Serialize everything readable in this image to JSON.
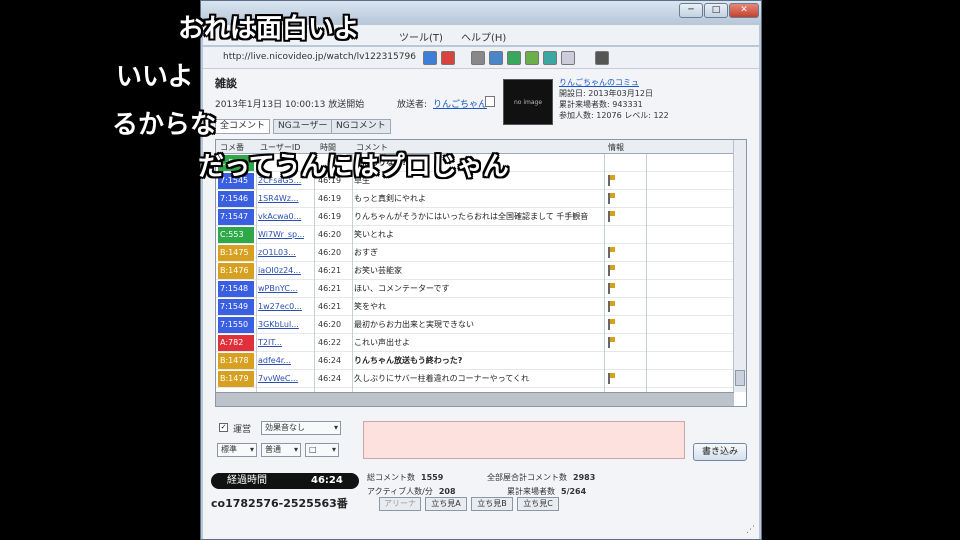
{
  "window": {
    "controls": {
      "minimize": "─",
      "maximize": "□",
      "close": "✕"
    },
    "menu": [
      "ツール(T)",
      "ヘルプ(H)"
    ],
    "url": "http://live.nicovideo.jp/watch/lv122315796",
    "colors": {
      "accent": "#1a56c8",
      "chrome": "#b9c7d6"
    }
  },
  "broadcast": {
    "title": "雑談",
    "start_time": "2013年1月13日 10:00:13 放送開始",
    "broadcaster_label": "放送者:",
    "broadcaster_name": "りんごちゃん",
    "thumbnail_text": "no image",
    "info_link": "りんごちゃんのコミュ",
    "info_lines": [
      "開設日: 2013年03月12日",
      "累計来場者数: 943331",
      "参加人数: 12076    レベル: 122"
    ]
  },
  "tabs": [
    "全コメント",
    "NGユーザー",
    "NGコメント"
  ],
  "grid": {
    "headers": {
      "no": "コメ番",
      "user": "ユーザーID",
      "time": "時間",
      "comment": "コメント",
      "info": "情報"
    },
    "rows": [
      {
        "no": "C:540",
        "color": "#2fa84a",
        "user": "",
        "time": "",
        "text": "せはありなの?",
        "bold": true,
        "flag": false
      },
      {
        "no": "7:1545",
        "color": "#3a5fe0",
        "user": "2CFsaG5...",
        "time": "46:19",
        "text": "草生",
        "bold": false,
        "flag": true
      },
      {
        "no": "7:1546",
        "color": "#3a5fe0",
        "user": "1SR4Wz...",
        "time": "46:19",
        "text": "もっと真剣にやれよ",
        "bold": false,
        "flag": true
      },
      {
        "no": "7:1547",
        "color": "#3a5fe0",
        "user": "vkAcwa0...",
        "time": "46:19",
        "text": "りんちゃんがそうかにはいったらおれは全国確認まして 千手観音",
        "bold": false,
        "flag": true
      },
      {
        "no": "C:553",
        "color": "#2fa84a",
        "user": "Wi7Wr_sp...",
        "time": "46:20",
        "text": "笑いとれよ",
        "bold": false,
        "flag": false
      },
      {
        "no": "B:1475",
        "color": "#d8a020",
        "user": "zO1L03...",
        "time": "46:20",
        "text": "おすぎ",
        "bold": false,
        "flag": true
      },
      {
        "no": "B:1476",
        "color": "#d8a020",
        "user": "iaOI0z24...",
        "time": "46:21",
        "text": "お笑い芸能家",
        "bold": false,
        "flag": true
      },
      {
        "no": "7:1548",
        "color": "#3a5fe0",
        "user": "wPBnYC...",
        "time": "46:21",
        "text": "ほい、コメンテーターです",
        "bold": false,
        "flag": true
      },
      {
        "no": "7:1549",
        "color": "#3a5fe0",
        "user": "1w27ec0...",
        "time": "46:21",
        "text": "笑をやれ",
        "bold": false,
        "flag": true
      },
      {
        "no": "7:1550",
        "color": "#3a5fe0",
        "user": "3GKbLul...",
        "time": "46:20",
        "text": "最初からお力出来と実現できない",
        "bold": false,
        "flag": true
      },
      {
        "no": "A:782",
        "color": "#e0303a",
        "user": "T2IT...",
        "time": "46:22",
        "text": "これい声出せよ",
        "bold": false,
        "flag": true
      },
      {
        "no": "B:1478",
        "color": "#d8a020",
        "user": "adfe4r...",
        "time": "46:24",
        "text": "りんちゃん放送もう終わった?",
        "bold": true,
        "flag": false
      },
      {
        "no": "B:1479",
        "color": "#d8a020",
        "user": "7vvWeC...",
        "time": "46:24",
        "text": "久しぶりにサバー柱着違れのコーナーやってくれ",
        "bold": false,
        "flag": true
      }
    ]
  },
  "controls": {
    "checkbox_checked": "✓",
    "checkbox_label": "運営",
    "dropdown_effect": "効果音なし",
    "dropdown_1": "標準",
    "dropdown_2": "普通",
    "dropdown_3": "□",
    "post_button": "書き込み"
  },
  "status": {
    "elapsed_label": "経過時間",
    "elapsed_value": "46:24",
    "community_id": "co1782576-2525563番",
    "total_comments_label": "総コメント数",
    "total_comments": "1559",
    "active_label": "アクティブ人数/分",
    "active": "208",
    "all_comments_label": "全部屋合計コメント数",
    "all_comments": "2983",
    "listeners_label": "累計来場者数",
    "listeners": "5/264",
    "room_buttons": [
      "アリーナ",
      "立ち見A",
      "立ち見B",
      "立ち見C"
    ]
  },
  "subtitles": [
    "おれは面白いよ",
    "いいよ",
    "るからな",
    "だってうんにはプロじゃん"
  ]
}
